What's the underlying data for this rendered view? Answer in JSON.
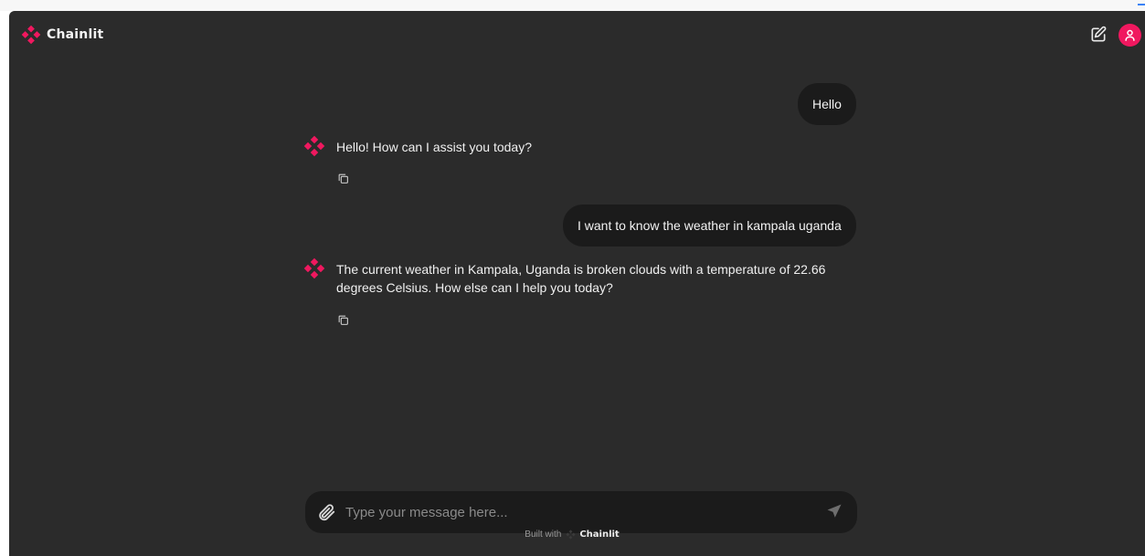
{
  "app": {
    "name": "Chainlit"
  },
  "header": {
    "new_chat_icon": "edit-icon",
    "avatar_icon": "user-icon"
  },
  "colors": {
    "accent": "#f0185f",
    "background": "#2b2b2b",
    "bubble": "#1b1b1b"
  },
  "messages": [
    {
      "role": "user",
      "text": "Hello"
    },
    {
      "role": "assistant",
      "text": "Hello! How can I assist you today?"
    },
    {
      "role": "user",
      "text": "I want to know the weather in kampala uganda"
    },
    {
      "role": "assistant",
      "text": "The current weather in Kampala, Uganda is broken clouds with a temperature of 22.66 degrees Celsius. How else can I help you today?"
    }
  ],
  "composer": {
    "placeholder": "Type your message here...",
    "value": ""
  },
  "footer": {
    "built_with": "Built with",
    "brand": "Chainlit"
  }
}
